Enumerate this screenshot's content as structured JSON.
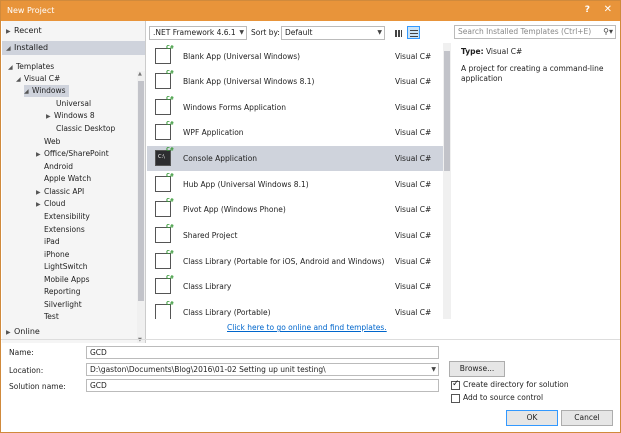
{
  "window": {
    "title": "New Project",
    "help_glyph": "?",
    "close_glyph": "✕"
  },
  "sidebar": {
    "recent": "Recent",
    "installed": "Installed",
    "templates": "Templates",
    "visual_csharp": "Visual C#",
    "windows": "Windows",
    "universal": "Universal",
    "windows8": "Windows 8",
    "classic_desktop": "Classic Desktop",
    "web": "Web",
    "office": "Office/SharePoint",
    "android": "Android",
    "apple_watch": "Apple Watch",
    "classic_api": "Classic API",
    "cloud": "Cloud",
    "extensibility": "Extensibility",
    "extensions": "Extensions",
    "ipad": "iPad",
    "iphone": "iPhone",
    "lightswitch": "LightSwitch",
    "mobile_apps": "Mobile Apps",
    "reporting": "Reporting",
    "silverlight": "Silverlight",
    "test": "Test",
    "online": "Online"
  },
  "toolbar": {
    "framework": ".NET Framework 4.6.1",
    "sort_label": "Sort by:",
    "sort_value": "Default",
    "search_placeholder": "Search Installed Templates (Ctrl+E)"
  },
  "templates": [
    {
      "name": "Blank App (Universal Windows)",
      "lang": "Visual C#"
    },
    {
      "name": "Blank App (Universal Windows 8.1)",
      "lang": "Visual C#"
    },
    {
      "name": "Windows Forms Application",
      "lang": "Visual C#"
    },
    {
      "name": "WPF Application",
      "lang": "Visual C#"
    },
    {
      "name": "Console Application",
      "lang": "Visual C#"
    },
    {
      "name": "Hub App (Universal Windows 8.1)",
      "lang": "Visual C#"
    },
    {
      "name": "Pivot App (Windows Phone)",
      "lang": "Visual C#"
    },
    {
      "name": "Shared Project",
      "lang": "Visual C#"
    },
    {
      "name": "Class Library (Portable for iOS, Android and Windows)",
      "lang": "Visual C#"
    },
    {
      "name": "Class Library",
      "lang": "Visual C#"
    },
    {
      "name": "Class Library (Portable)",
      "lang": "Visual C#"
    }
  ],
  "icon_badge": "C#",
  "console_prompt": "C:\\",
  "details": {
    "type_label": "Type:",
    "type_value": "Visual C#",
    "description": "A project for creating a command-line application"
  },
  "online_link": "Click here to go online and find templates.",
  "form": {
    "name_label": "Name:",
    "name_value": "GCD",
    "location_label": "Location:",
    "location_value": "D:\\gaston\\Documents\\Blog\\2016\\01-02 Setting up unit testing\\",
    "solution_label": "Solution name:",
    "solution_value": "GCD",
    "browse": "Browse...",
    "create_dir": "Create directory for solution",
    "create_dir_checked": true,
    "add_source": "Add to source control",
    "add_source_checked": false,
    "ok": "OK",
    "cancel": "Cancel"
  }
}
